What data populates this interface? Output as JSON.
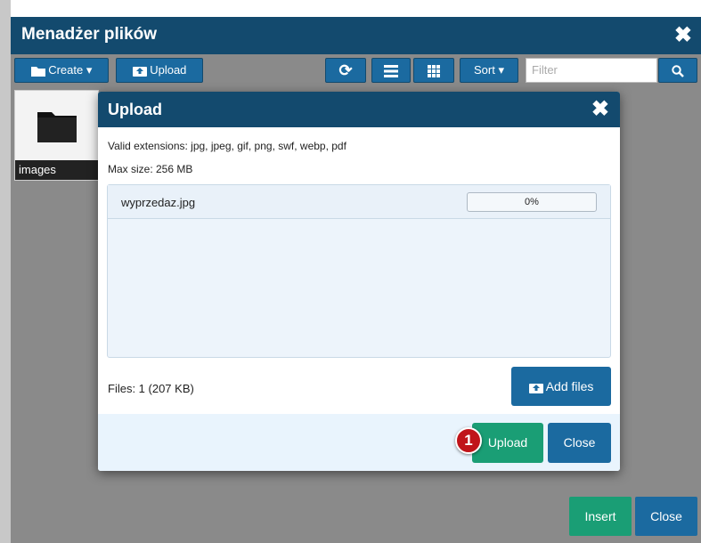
{
  "file_manager": {
    "title": "Menadżer plików",
    "toolbar": {
      "create_label": "Create",
      "upload_label": "Upload",
      "sort_label": "Sort",
      "filter_placeholder": "Filter"
    },
    "folders": [
      {
        "name": "images"
      }
    ],
    "footer": {
      "insert_label": "Insert",
      "close_label": "Close"
    }
  },
  "upload_dialog": {
    "title": "Upload",
    "valid_extensions": "Valid extensions: jpg, jpeg, gif, png, swf, webp, pdf",
    "max_size": "Max size: 256 MB",
    "files": [
      {
        "name": "wyprzedaz.jpg",
        "progress_text": "0%",
        "progress": 0
      }
    ],
    "files_count": "Files: 1 (207 KB)",
    "add_files_label": "Add files",
    "upload_label": "Upload",
    "close_label": "Close"
  },
  "annotation": {
    "step": "1"
  },
  "colors": {
    "header": "#134a6e",
    "primary": "#1b6aa0",
    "success": "#1a9e75",
    "badge": "#c0141a"
  }
}
